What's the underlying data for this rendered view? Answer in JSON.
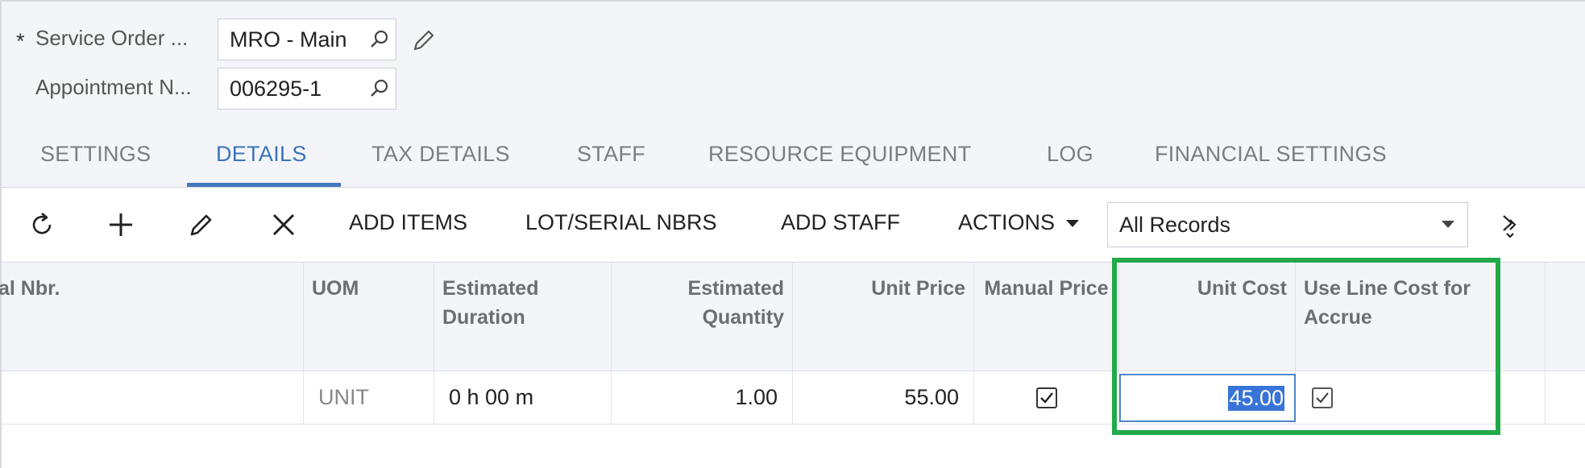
{
  "form": {
    "service_order": {
      "required_mark": "*",
      "label": "Service Order ...",
      "value": "MRO - Main"
    },
    "appointment": {
      "label": "Appointment N...",
      "value": "006295-1"
    }
  },
  "tabs": [
    {
      "label": "SETTINGS",
      "active": false
    },
    {
      "label": "DETAILS",
      "active": true
    },
    {
      "label": "TAX DETAILS",
      "active": false
    },
    {
      "label": "STAFF",
      "active": false
    },
    {
      "label": "RESOURCE EQUIPMENT",
      "active": false
    },
    {
      "label": "LOG",
      "active": false
    },
    {
      "label": "FINANCIAL SETTINGS",
      "active": false
    }
  ],
  "toolbar": {
    "icons": [
      "refresh-icon",
      "add-icon",
      "edit-icon",
      "delete-icon"
    ],
    "buttons": [
      "ADD ITEMS",
      "LOT/SERIAL NBRS",
      "ADD STAFF",
      "ACTIONS"
    ],
    "filter": {
      "value": "All Records"
    },
    "more": "more-icon"
  },
  "grid": {
    "columns": [
      "al Nbr.",
      "UOM",
      "Estimated Duration",
      "Estimated Quantity",
      "Unit Price",
      "Manual Price",
      "Unit Cost",
      "Use Line Cost for Accrue"
    ],
    "row": {
      "serial_nbr": "",
      "uom": "UNIT",
      "estimated_duration": "0 h 00 m",
      "estimated_quantity": "1.00",
      "unit_price": "55.00",
      "manual_price": true,
      "unit_cost": "45.00",
      "use_line_cost_for_accrue": true
    }
  },
  "colors": {
    "accent": "#3b73b9",
    "highlight": "#22aa4a",
    "selection": "#3874d8"
  }
}
